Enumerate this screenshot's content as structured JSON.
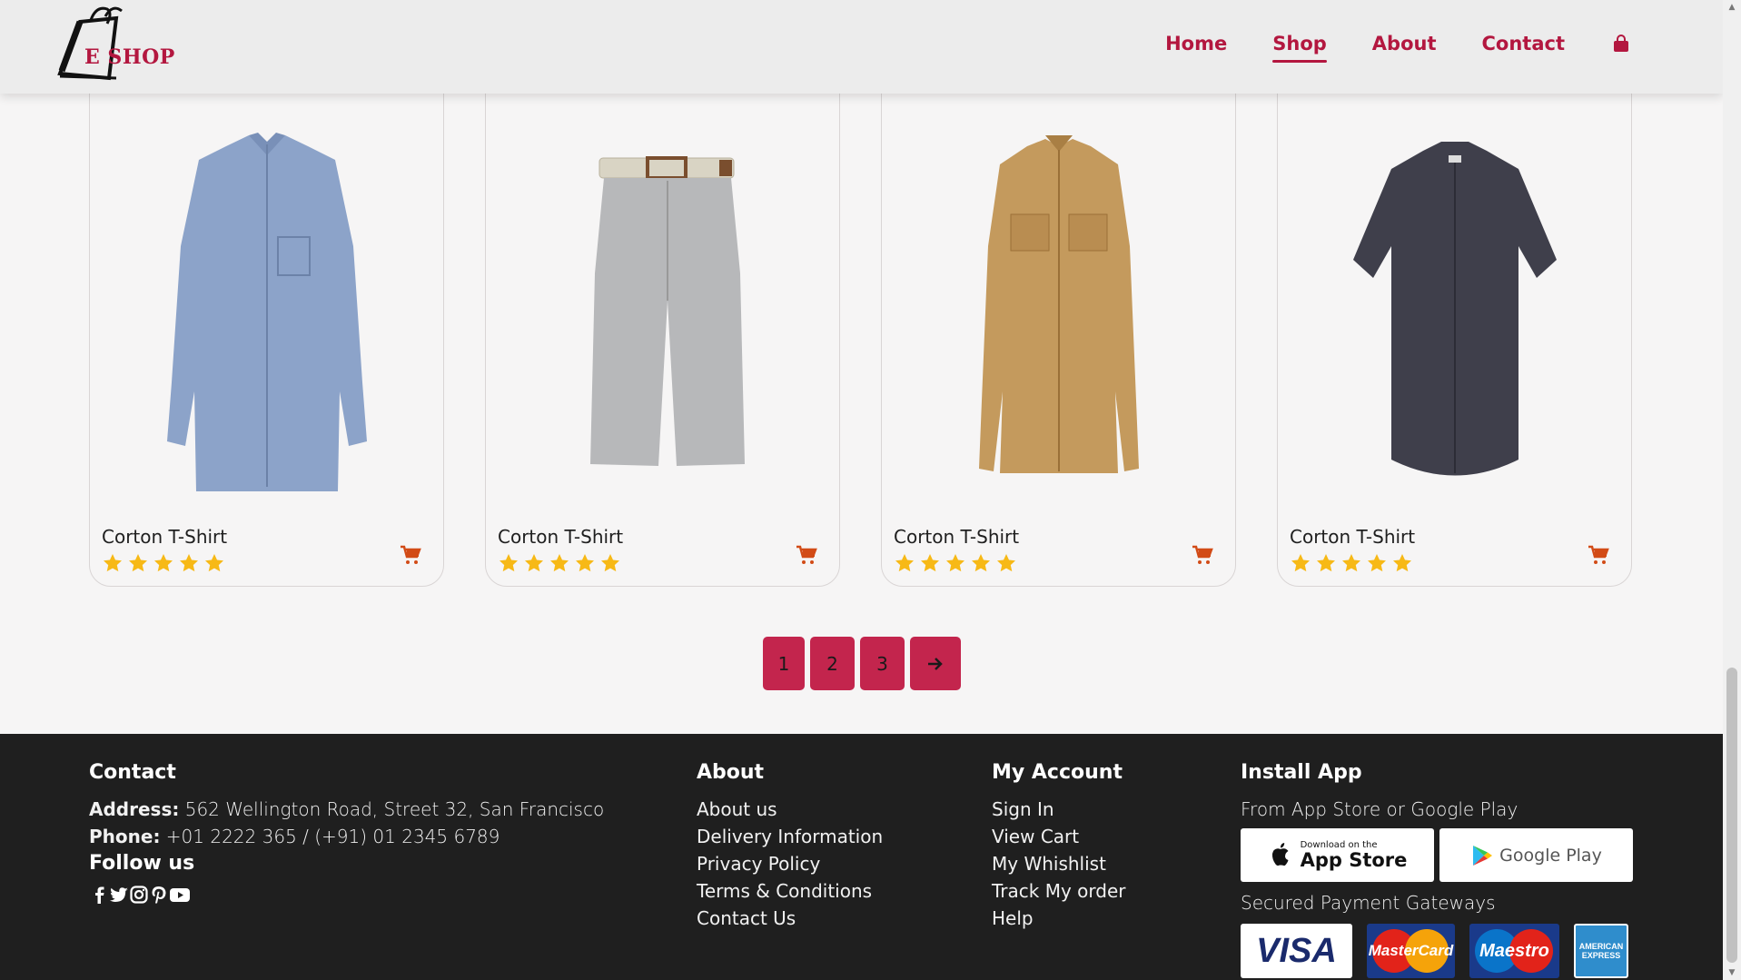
{
  "header": {
    "logo_text": "E SHOP",
    "nav": [
      {
        "label": "Home",
        "active": false
      },
      {
        "label": "Shop",
        "active": true
      },
      {
        "label": "About",
        "active": false
      },
      {
        "label": "Contact",
        "active": false
      }
    ],
    "bag_icon": "shopping-bag-icon"
  },
  "products": [
    {
      "name": "Corton T-Shirt",
      "rating": 5,
      "image": "blue-denim-shirt",
      "cart_icon": "cart-icon"
    },
    {
      "name": "Corton T-Shirt",
      "rating": 5,
      "image": "striped-shorts-with-belt",
      "cart_icon": "cart-icon"
    },
    {
      "name": "Corton T-Shirt",
      "rating": 5,
      "image": "tan-overshirt",
      "cart_icon": "cart-icon"
    },
    {
      "name": "Corton T-Shirt",
      "rating": 5,
      "image": "charcoal-short-sleeve-shirt",
      "cart_icon": "cart-icon"
    }
  ],
  "pagination": {
    "pages": [
      "1",
      "2",
      "3"
    ],
    "next_icon": "arrow-right-icon"
  },
  "footer": {
    "contact": {
      "heading": "Contact",
      "address_label": "Address:",
      "address_value": " 562 Wellington Road, Street 32, San Francisco",
      "phone_label": "Phone:",
      "phone_value": " +01 2222 365 / (+91) 01 2345 6789",
      "follow_heading": "Follow us",
      "social_icons": [
        "facebook-icon",
        "twitter-icon",
        "instagram-icon",
        "pinterest-icon",
        "youtube-icon"
      ]
    },
    "about": {
      "heading": "About",
      "links": [
        "About us",
        "Delivery Information",
        "Privacy Policy",
        "Terms & Conditions",
        "Contact Us"
      ]
    },
    "account": {
      "heading": "My Account",
      "links": [
        "Sign In",
        "View Cart",
        "My Whishlist",
        "Track My order",
        "Help"
      ]
    },
    "install": {
      "heading": "Install App",
      "subtitle": "From App Store or Google Play",
      "app_store_small": "Download on the",
      "app_store_big": "App Store",
      "google_play": "Google Play",
      "payments_heading": "Secured Payment Gateways",
      "payments": [
        "VISA",
        "MasterCard",
        "Maestro",
        "AMERICAN EXPRESS"
      ]
    }
  },
  "colors": {
    "brand": "#b3173f",
    "pagination": "#c3254d",
    "star": "#f7b916",
    "cart": "#d24b16",
    "footer_bg": "#1f1f1f"
  }
}
